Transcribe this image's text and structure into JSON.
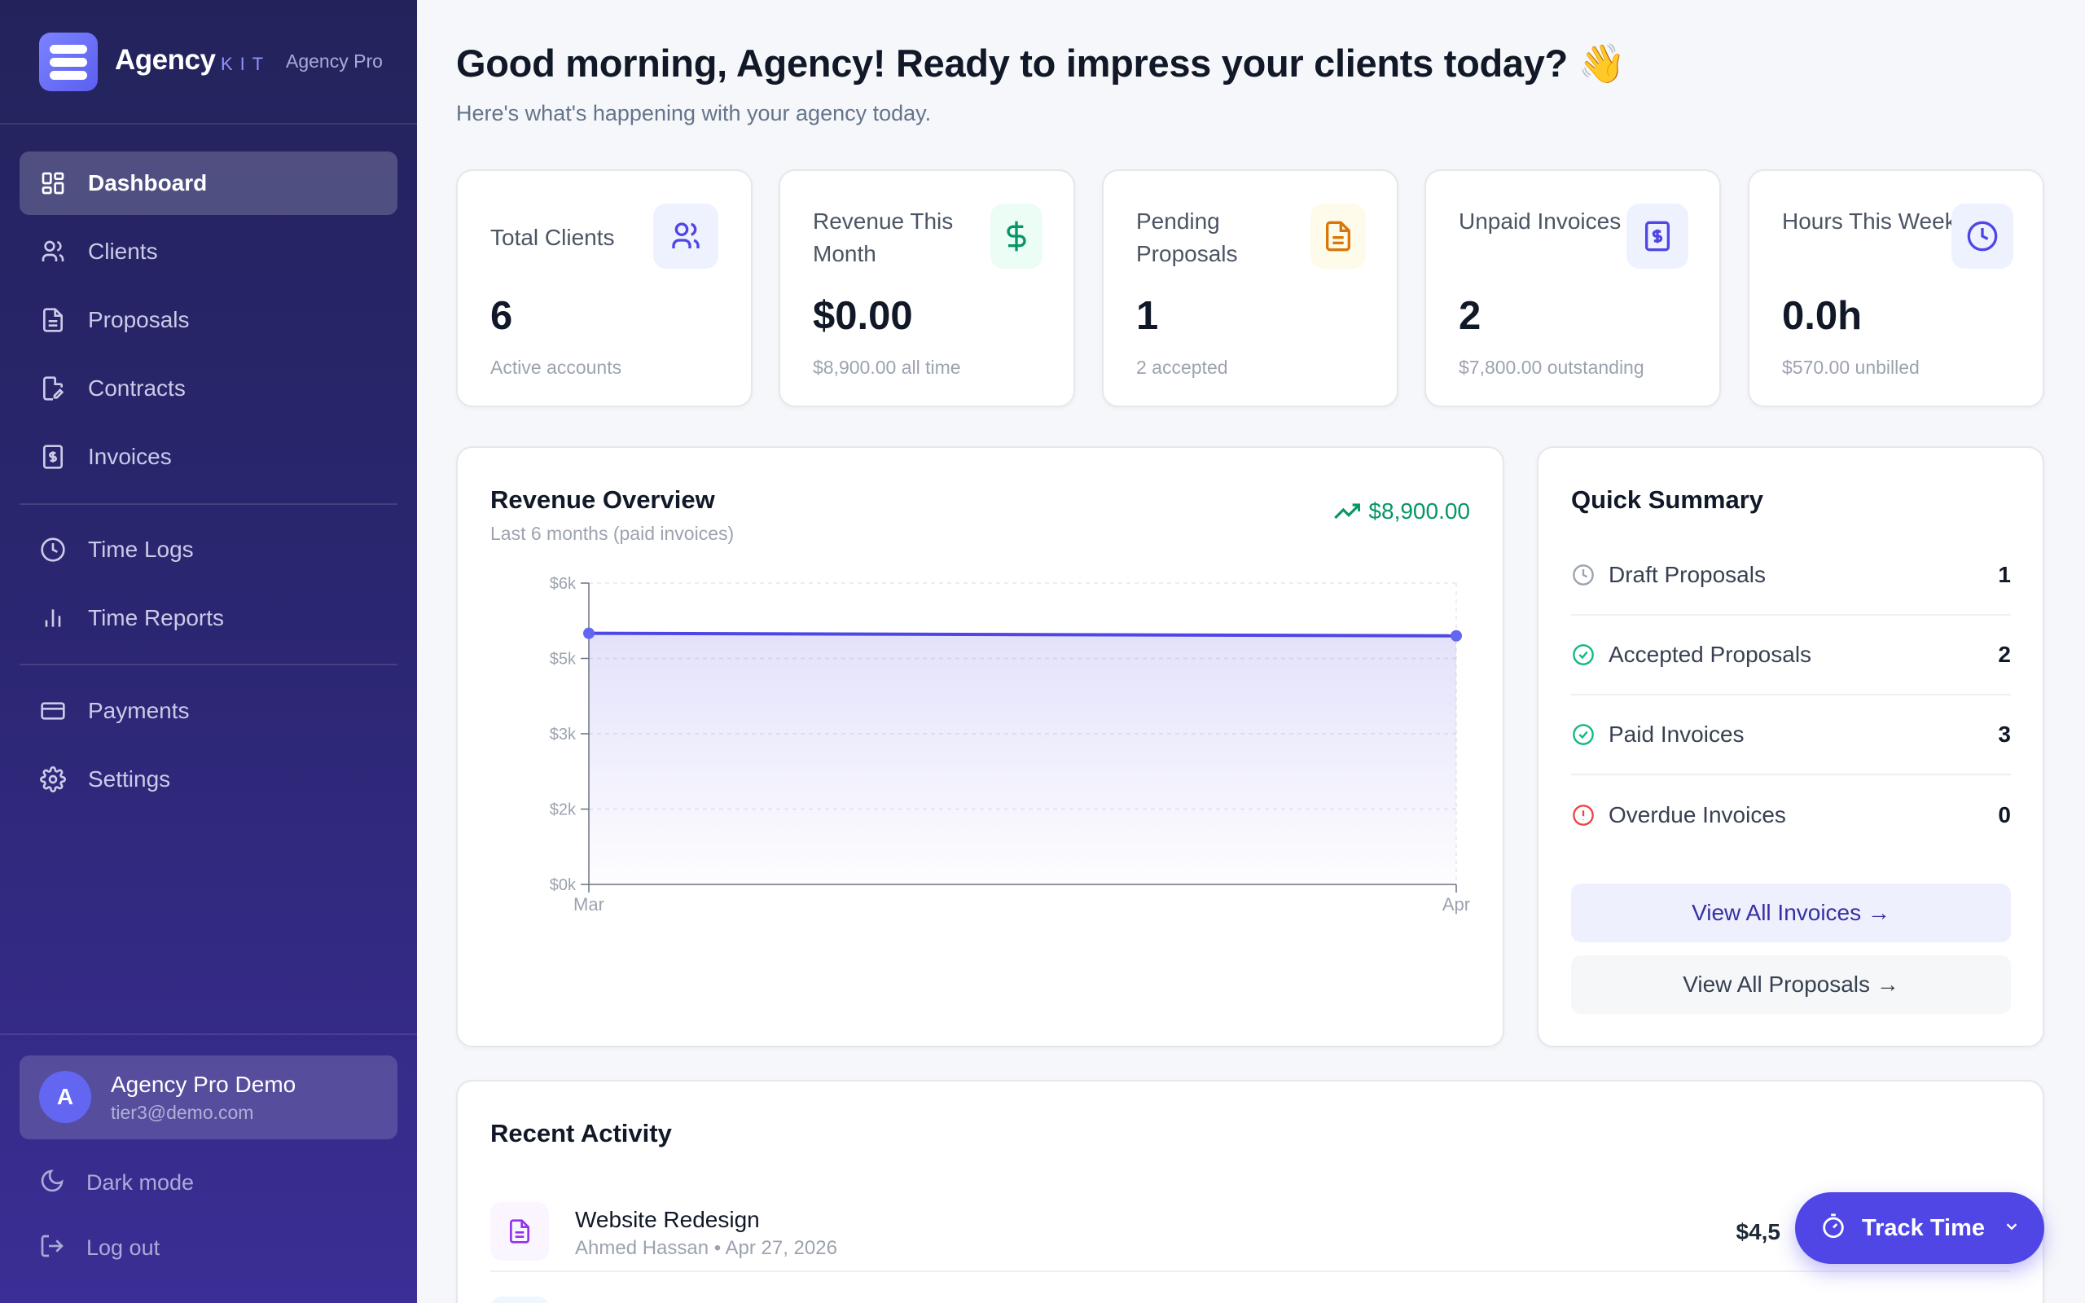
{
  "brand": {
    "name": "Agency",
    "kit": "KIT",
    "tier": "Agency Pro"
  },
  "nav": {
    "items": [
      {
        "label": "Dashboard",
        "icon": "dashboard-icon",
        "active": true
      },
      {
        "label": "Clients",
        "icon": "users-icon"
      },
      {
        "label": "Proposals",
        "icon": "document-icon"
      },
      {
        "label": "Contracts",
        "icon": "contract-icon"
      },
      {
        "label": "Invoices",
        "icon": "invoice-icon"
      },
      {
        "label": "Time Logs",
        "icon": "clock-icon"
      },
      {
        "label": "Time Reports",
        "icon": "bar-chart-icon"
      },
      {
        "label": "Payments",
        "icon": "credit-card-icon"
      },
      {
        "label": "Settings",
        "icon": "gear-icon"
      }
    ]
  },
  "user": {
    "initial": "A",
    "name": "Agency Pro Demo",
    "email": "tier3@demo.com"
  },
  "footer": {
    "dark_mode": "Dark mode",
    "logout": "Log out"
  },
  "header": {
    "greeting": "Good morning, Agency! Ready to impress your clients today? 👋",
    "subtitle": "Here's what's happening with your agency today."
  },
  "stats": [
    {
      "title": "Total Clients",
      "value": "6",
      "sub": "Active accounts",
      "icon": "users-icon",
      "color": "#4f46e5"
    },
    {
      "title": "Revenue This Month",
      "value": "$0.00",
      "sub": "$8,900.00 all time",
      "icon": "dollar-icon",
      "color": "#059669"
    },
    {
      "title": "Pending Proposals",
      "value": "1",
      "sub": "2 accepted",
      "icon": "document-icon",
      "color": "#d97706"
    },
    {
      "title": "Unpaid Invoices",
      "value": "2",
      "sub": "$7,800.00 outstanding",
      "icon": "invoice-icon",
      "color": "#4f46e5"
    },
    {
      "title": "Hours This Week",
      "value": "0.0h",
      "sub": "$570.00 unbilled",
      "icon": "clock-icon",
      "color": "#4f46e5"
    }
  ],
  "revenue": {
    "title": "Revenue Overview",
    "subtitle": "Last 6 months (paid invoices)",
    "total": "$8,900.00"
  },
  "chart_data": {
    "type": "area",
    "x": [
      "Mar",
      "Apr"
    ],
    "values": [
      5000,
      4950
    ],
    "yticks": [
      "$0k",
      "$2k",
      "$3k",
      "$5k",
      "$6k"
    ],
    "ylim": [
      0,
      6000
    ],
    "grid": true,
    "color": "#4f46e5"
  },
  "summary": {
    "title": "Quick Summary",
    "rows": [
      {
        "label": "Draft Proposals",
        "count": "1",
        "icon": "clock-icon",
        "color": "#9ca3af"
      },
      {
        "label": "Accepted Proposals",
        "count": "2",
        "icon": "check-circle-icon",
        "color": "#10b981"
      },
      {
        "label": "Paid Invoices",
        "count": "3",
        "icon": "check-circle-icon",
        "color": "#10b981"
      },
      {
        "label": "Overdue Invoices",
        "count": "0",
        "icon": "alert-circle-icon",
        "color": "#ef4444"
      }
    ],
    "view_invoices": "View All Invoices →",
    "view_proposals": "View All Proposals →"
  },
  "activity": {
    "title": "Recent Activity",
    "items": [
      {
        "title": "Website Redesign",
        "meta": "Ahmed Hassan • Apr 27, 2026",
        "amount": "$4,5",
        "icon": "document-icon"
      }
    ]
  },
  "track_time": {
    "label": "Track Time"
  }
}
